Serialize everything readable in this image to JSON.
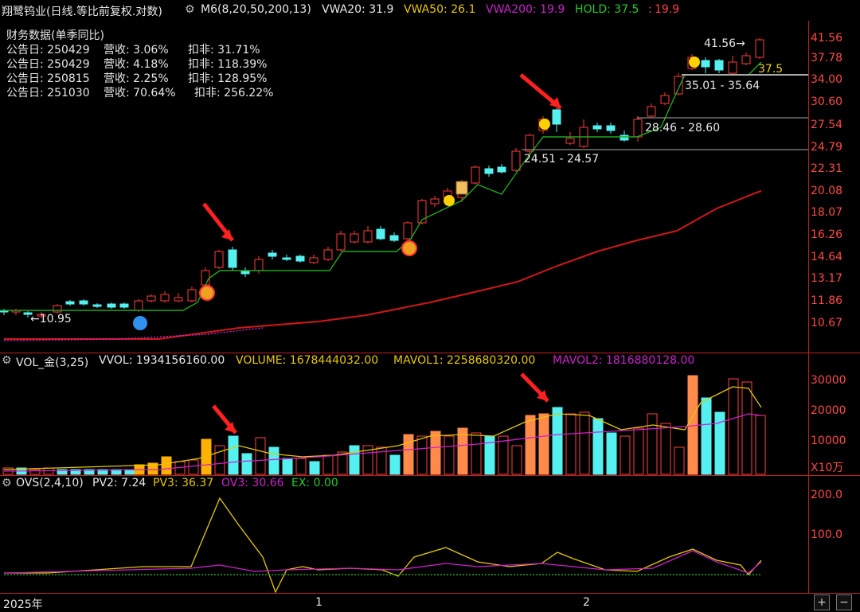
{
  "header": {
    "stock_name": "翔鹭钨业(日线.等比前复权.对数)",
    "m6_label": "M6(8,20,50,200,13)",
    "vwa20": "VWA20: 31.9",
    "vwa50": "VWA50: 26.1",
    "vwa200": "VWA200: 19.9",
    "hold": "HOLD: 37.5",
    "hold_sep": ":",
    "last": "19.9"
  },
  "finance": {
    "title": "财务数据(单季同比)",
    "rows": [
      {
        "date": "公告日: 250429",
        "rev": "营收: 3.06%",
        "profit": "扣非: 31.71%"
      },
      {
        "date": "公告日: 250429",
        "rev": "营收: 4.18%",
        "profit": "扣非: 118.39%"
      },
      {
        "date": "公告日: 250815",
        "rev": "营收: 2.25%",
        "profit": "扣非: 128.95%"
      },
      {
        "date": "公告日: 251030",
        "rev": "营收: 70.64%",
        "profit": "扣非: 256.22%"
      }
    ]
  },
  "price_axis": [
    "41.56",
    "37.78",
    "34.00",
    "30.60",
    "27.54",
    "24.79",
    "22.31",
    "20.08",
    "18.07",
    "16.26",
    "14.64",
    "13.17",
    "11.86",
    "10.67"
  ],
  "annotations": {
    "low_label": "10.95",
    "high_label": "41.56",
    "hold_value": "37.5",
    "range1": "24.51 - 24.57",
    "range2": "28.46 - 28.60",
    "range3": "35.01 - 35.64"
  },
  "volume": {
    "label": "VOL_金(3,25)",
    "vvol": "VVOL: 1934156160.00",
    "volume": "VOLUME: 1678444032.00",
    "mavol1": "MAVOL1: 2258680320.00",
    "mavol2": "MAVOL2: 1816880128.00",
    "axis": [
      "30000",
      "20000",
      "10000"
    ],
    "unit": "X10万"
  },
  "ovs": {
    "label": "OVS(2,4,10)",
    "pv2": "PV2: 7.24",
    "pv3": "PV3: 36.37",
    "ov3": "OV3: 30.66",
    "ex": "EX: 0.00",
    "axis": [
      "200.0",
      "100.0"
    ]
  },
  "time_axis": {
    "year": "2025年",
    "m1": "1",
    "m2": "2"
  },
  "colors": {
    "up": "#ff3b3b",
    "down": "#55f0f0",
    "ma_green": "#1fa81f",
    "ma_red": "#d01818",
    "yellow": "#e6d400",
    "magenta": "#cc22cc",
    "orange": "#ff8a4a"
  },
  "controls": {
    "plus": "+",
    "minus": "−"
  }
}
